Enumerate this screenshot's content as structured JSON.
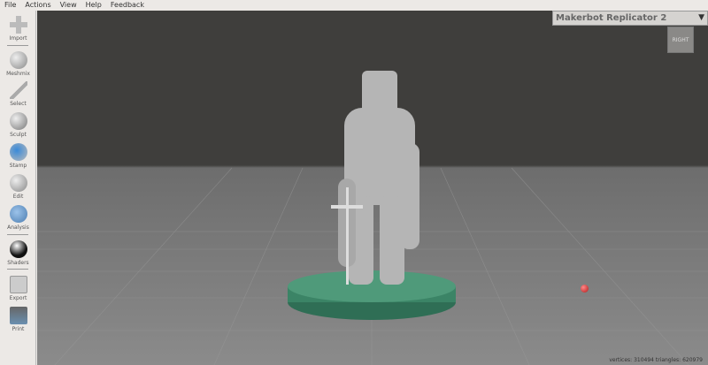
{
  "menu": [
    "File",
    "Actions",
    "View",
    "Help",
    "Feedback"
  ],
  "tools": [
    {
      "label": "Import",
      "icon": "plus-icon"
    },
    {
      "label": "Meshmix",
      "icon": "meshmix-icon"
    },
    {
      "label": "Select",
      "icon": "select-arrow-icon"
    },
    {
      "label": "Sculpt",
      "icon": "brush-icon"
    },
    {
      "label": "Stamp",
      "icon": "stamp-icon"
    },
    {
      "label": "Edit",
      "icon": "edit-icon"
    },
    {
      "label": "Analysis",
      "icon": "analysis-icon"
    },
    {
      "label": "Shaders",
      "icon": "shader-sphere-icon"
    },
    {
      "label": "Export",
      "icon": "export-icon"
    },
    {
      "label": "Print",
      "icon": "print-icon"
    }
  ],
  "printer": {
    "selected": "Makerbot Replicator 2"
  },
  "view_cube": "RIGHT",
  "stats": "vertices: 310494 triangles: 620979"
}
